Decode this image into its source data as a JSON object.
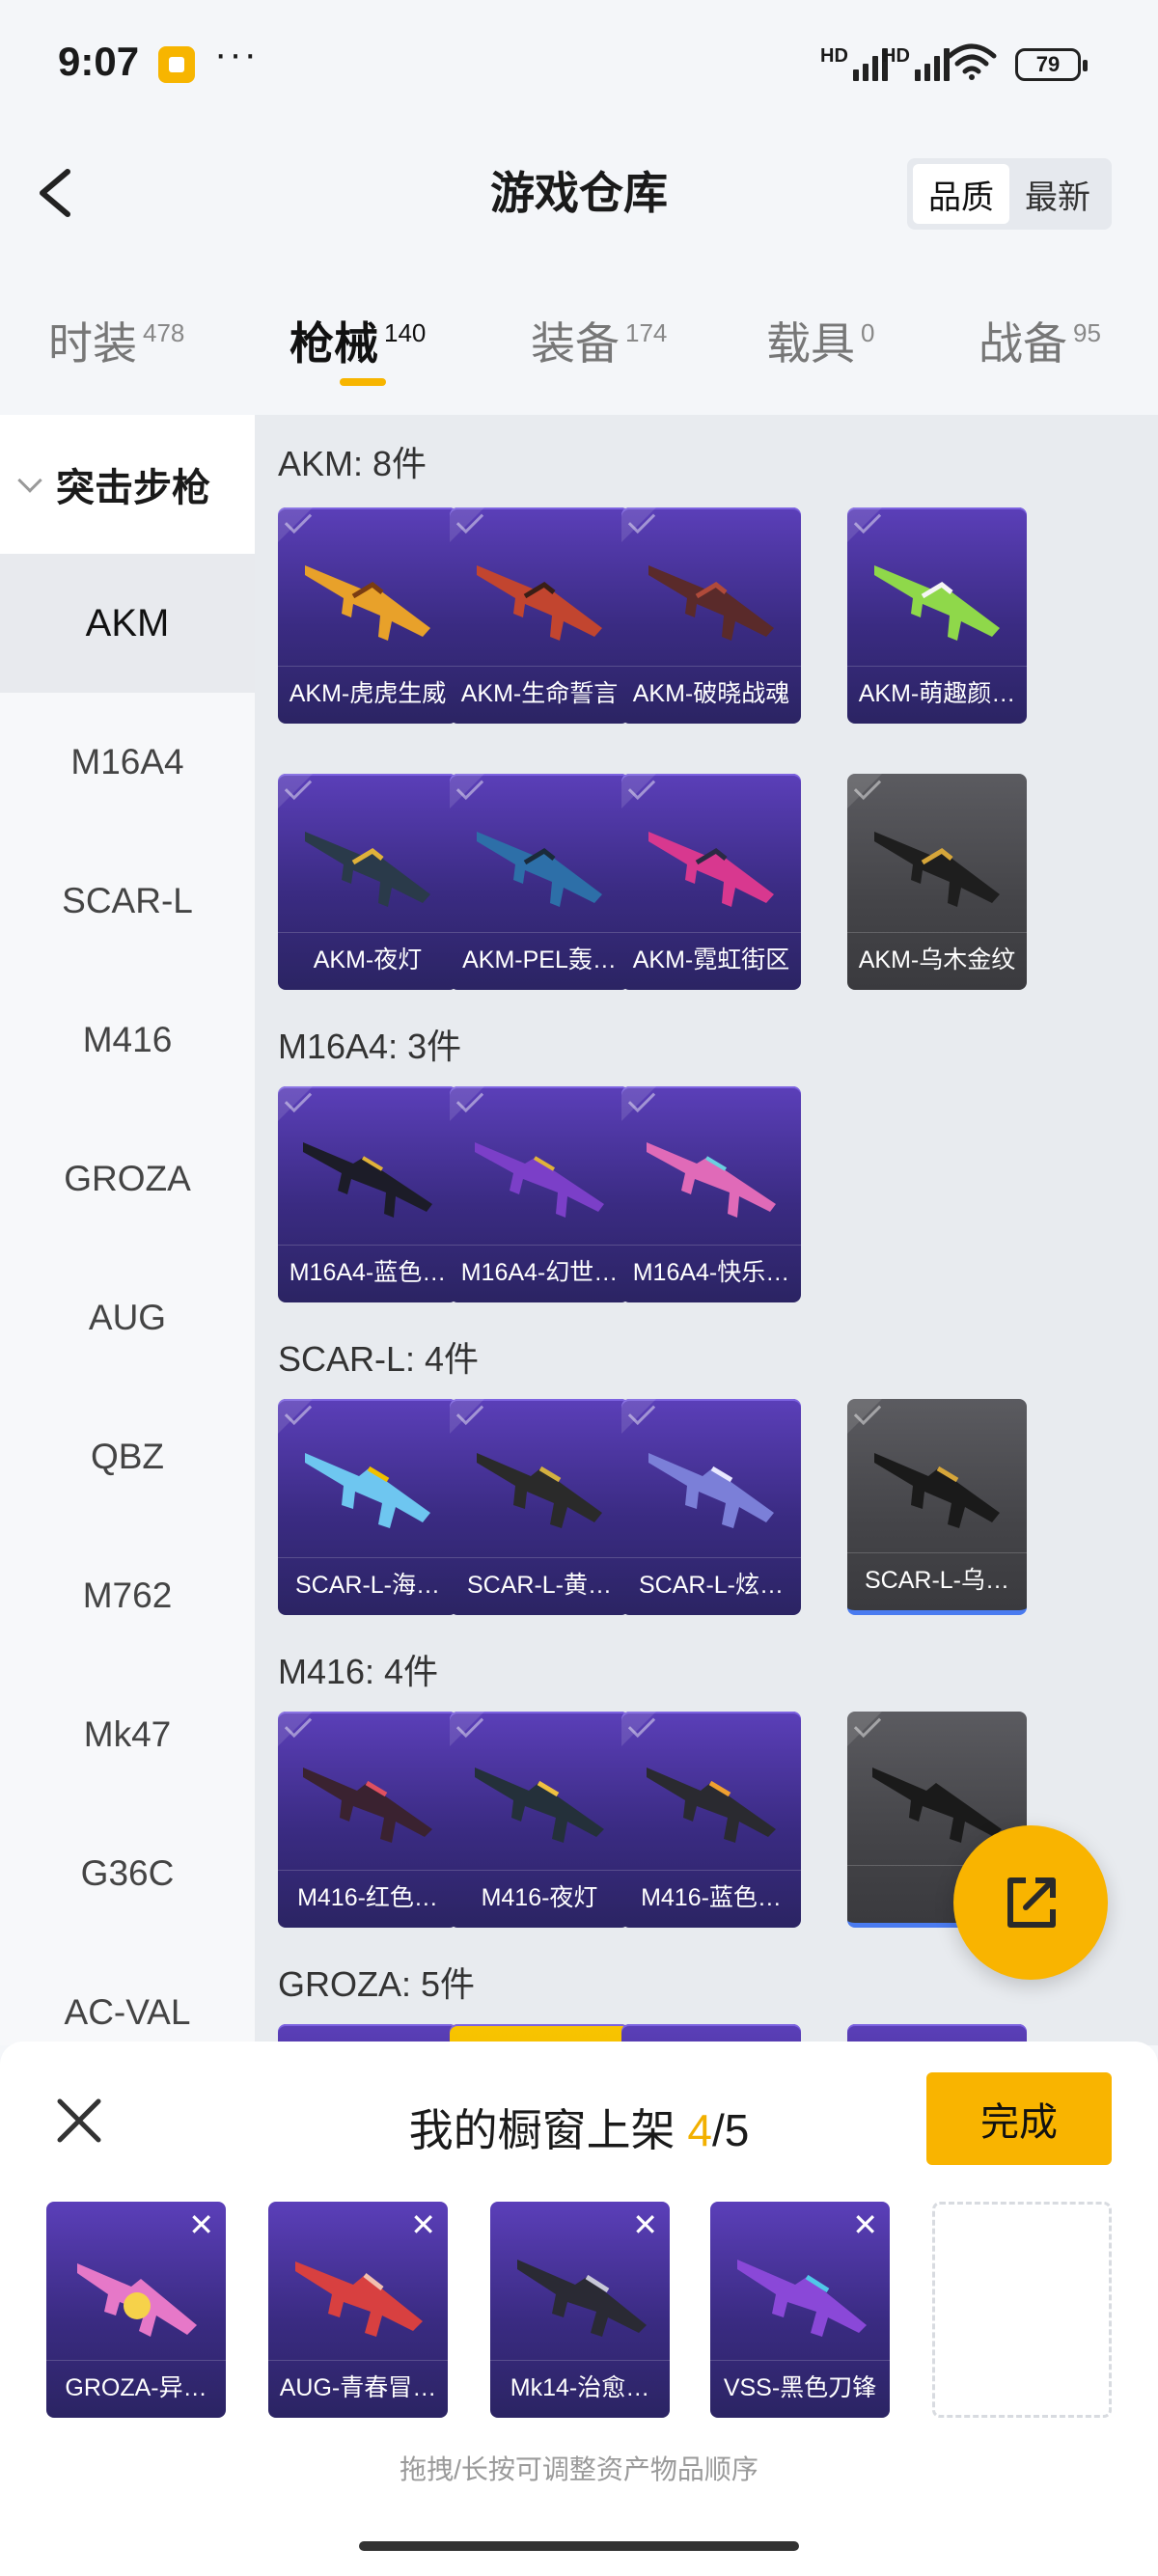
{
  "status": {
    "time": "9:07",
    "battery": "79",
    "hd1": "HD",
    "hd2": "HD",
    "more": "···"
  },
  "nav": {
    "title": "游戏仓库",
    "sort": [
      "品质",
      "最新"
    ]
  },
  "tabs": [
    {
      "label": "时装",
      "count": "478"
    },
    {
      "label": "枪械",
      "count": "140"
    },
    {
      "label": "装备",
      "count": "174"
    },
    {
      "label": "载具",
      "count": "0"
    },
    {
      "label": "战备",
      "count": "95"
    }
  ],
  "sidebar": {
    "category": "突击步枪",
    "items": [
      "AKM",
      "M16A4",
      "SCAR-L",
      "M416",
      "GROZA",
      "AUG",
      "QBZ",
      "M762",
      "Mk47",
      "G36C",
      "AC-VAL"
    ]
  },
  "sections": [
    {
      "title": "AKM: 8件",
      "items": [
        "AKM-虎虎生威",
        "AKM-生命誓言",
        "AKM-破晓战魂",
        "AKM-萌趣颜…",
        "AKM-夜灯",
        "AKM-PEL轰…",
        "AKM-霓虹街区",
        "AKM-乌木金纹"
      ]
    },
    {
      "title": "M16A4: 3件",
      "items": [
        "M16A4-蓝色…",
        "M16A4-幻世…",
        "M16A4-快乐…"
      ]
    },
    {
      "title": "SCAR-L: 4件",
      "items": [
        "SCAR-L-海…",
        "SCAR-L-黄…",
        "SCAR-L-炫…",
        "SCAR-L-乌…"
      ]
    },
    {
      "title": "M416: 4件",
      "items": [
        "M416-红色…",
        "M416-夜灯",
        "M416-蓝色…",
        ""
      ]
    },
    {
      "title": "GROZA: 5件",
      "items": []
    }
  ],
  "sheet": {
    "title": "我的橱窗上架 ",
    "count": "4",
    "total": "/5",
    "done": "完成",
    "items": [
      "GROZA-异…",
      "AUG-青春冒…",
      "Mk14-治愈…",
      "VSS-黑色刀锋"
    ],
    "hint": "拖拽/长按可调整资产物品顺序"
  },
  "colors": {
    "accent": "#f9b400",
    "card_purple": "#3a2b82",
    "card_gray": "#444448"
  }
}
